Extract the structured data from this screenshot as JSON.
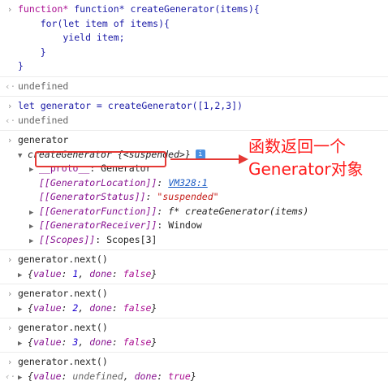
{
  "entries": [
    {
      "input": [
        "function* createGenerator(items){",
        "    for(let item of items){",
        "        yield item;",
        "    }",
        "}"
      ],
      "result": "undefined"
    },
    {
      "input": [
        "let generator = createGenerator([1,2,3])"
      ],
      "result": "undefined"
    },
    {
      "input": [
        "generator"
      ],
      "object": {
        "header": "createGenerator {<suspended>}",
        "props": [
          {
            "key": "__proto__",
            "sep": ": ",
            "value": "Generator"
          },
          {
            "key": "[[GeneratorLocation]]",
            "sep": ": ",
            "value": "VM328:1"
          },
          {
            "key": "[[GeneratorStatus]]",
            "sep": ": ",
            "value": "\"suspended\""
          },
          {
            "key": "[[GeneratorFunction]]",
            "sep": ": ",
            "value": "f* createGenerator(items)"
          },
          {
            "key": "[[GeneratorReceiver]]",
            "sep": ": ",
            "value": "Window"
          },
          {
            "key": "[[Scopes]]",
            "sep": ": ",
            "value": "Scopes[3]"
          }
        ]
      }
    },
    {
      "input": [
        "generator.next()"
      ],
      "result_obj": {
        "value": "1",
        "done": "false"
      }
    },
    {
      "input": [
        "generator.next()"
      ],
      "result_obj": {
        "value": "2",
        "done": "false"
      }
    },
    {
      "input": [
        "generator.next()"
      ],
      "result_obj": {
        "value": "3",
        "done": "false"
      }
    },
    {
      "input": [
        "generator.next()"
      ],
      "result_obj": {
        "value": "undefined",
        "done": "true"
      }
    }
  ],
  "annotation": {
    "line1": "函数返回一个",
    "line2": "Generator对象"
  },
  "icons": {
    "prompt": "chevron-right-icon",
    "result": "return-arrow-icon",
    "expand": "triangle-icon",
    "info": "info-icon"
  },
  "colors": {
    "annotation": "#ff1a1a",
    "keyword": "#aa0d91",
    "property": "#881391",
    "string": "#c41a16"
  }
}
